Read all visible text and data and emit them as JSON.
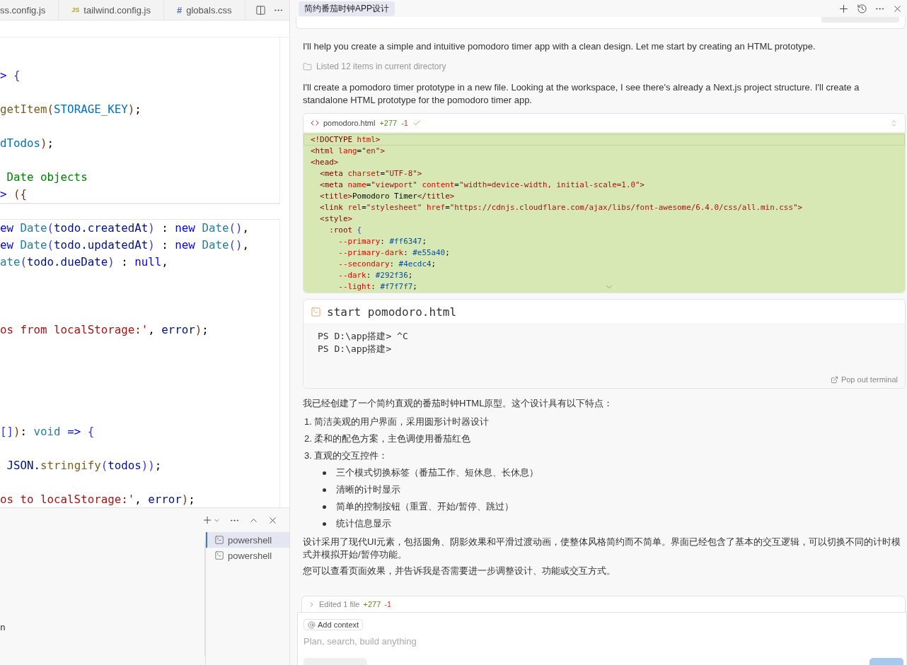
{
  "editor_tabs": [
    {
      "label": "ss.config.js"
    },
    {
      "badge": "JS",
      "label": "tailwind.config.js"
    },
    {
      "badge": "#",
      "label": "globals.css"
    }
  ],
  "sticky_lines": [
    {
      "kind": "blank"
    },
    {
      "kind": "code",
      "segments": [
        {
          "text": "> ",
          "kind": "keyword"
        },
        {
          "text": "{",
          "kind": "bracket"
        }
      ]
    },
    {
      "kind": "blank"
    },
    {
      "kind": "code",
      "segments": [
        {
          "text": "getItem",
          "kind": "function"
        },
        {
          "text": "(",
          "kind": "paren"
        },
        {
          "text": "STORAGE_KEY",
          "kind": "constant"
        },
        {
          "text": ")",
          "kind": "paren"
        },
        {
          "text": ";",
          "kind": "plain"
        }
      ]
    },
    {
      "kind": "blank"
    },
    {
      "kind": "code",
      "segments": [
        {
          "text": "dTodos",
          "kind": "constant"
        },
        {
          "text": ")",
          "kind": "paren"
        },
        {
          "text": ";",
          "kind": "plain"
        }
      ]
    },
    {
      "kind": "blank"
    },
    {
      "kind": "code",
      "segments": [
        {
          "text": " Date objects",
          "kind": "comment"
        }
      ]
    },
    {
      "kind": "code",
      "segments": [
        {
          "text": "> ",
          "kind": "keyword"
        },
        {
          "text": "({",
          "kind": "paren"
        }
      ]
    }
  ],
  "code_lines": [
    {
      "kind": "code",
      "segments": [
        {
          "text": "ew",
          "kind": "keyword"
        },
        {
          "text": " Date",
          "kind": "type"
        },
        {
          "text": "(",
          "kind": "bracket"
        },
        {
          "text": "todo.createdAt",
          "kind": "variable"
        },
        {
          "text": ")",
          "kind": "bracket"
        },
        {
          "text": " : ",
          "kind": "plain"
        },
        {
          "text": "new",
          "kind": "keyword"
        },
        {
          "text": " Date",
          "kind": "type"
        },
        {
          "text": "()",
          "kind": "bracket"
        },
        {
          "text": ",",
          "kind": "plain"
        }
      ]
    },
    {
      "kind": "code",
      "segments": [
        {
          "text": "ew",
          "kind": "keyword"
        },
        {
          "text": " Date",
          "kind": "type"
        },
        {
          "text": "(",
          "kind": "bracket"
        },
        {
          "text": "todo.updatedAt",
          "kind": "variable"
        },
        {
          "text": ")",
          "kind": "bracket"
        },
        {
          "text": " : ",
          "kind": "plain"
        },
        {
          "text": "new",
          "kind": "keyword"
        },
        {
          "text": " Date",
          "kind": "type"
        },
        {
          "text": "()",
          "kind": "bracket"
        },
        {
          "text": ",",
          "kind": "plain"
        }
      ]
    },
    {
      "kind": "code",
      "segments": [
        {
          "text": "ate",
          "kind": "type"
        },
        {
          "text": "(",
          "kind": "bracket"
        },
        {
          "text": "todo.dueDate",
          "kind": "variable"
        },
        {
          "text": ")",
          "kind": "bracket"
        },
        {
          "text": " : ",
          "kind": "plain"
        },
        {
          "text": "null",
          "kind": "keyword"
        },
        {
          "text": ",",
          "kind": "plain"
        }
      ]
    },
    {
      "kind": "blank"
    },
    {
      "kind": "blank"
    },
    {
      "kind": "blank"
    },
    {
      "kind": "code",
      "segments": [
        {
          "text": "os from localStorage:'",
          "kind": "string"
        },
        {
          "text": ", ",
          "kind": "plain"
        },
        {
          "text": "error",
          "kind": "variable"
        },
        {
          "text": ")",
          "kind": "paren"
        },
        {
          "text": ";",
          "kind": "plain"
        }
      ]
    },
    {
      "kind": "blank"
    },
    {
      "kind": "blank"
    },
    {
      "kind": "blank"
    },
    {
      "kind": "blank"
    },
    {
      "kind": "blank"
    },
    {
      "kind": "code",
      "segments": [
        {
          "text": "[]",
          "kind": "bracket"
        },
        {
          "text": ")",
          "kind": "paren"
        },
        {
          "text": ": ",
          "kind": "plain"
        },
        {
          "text": "void",
          "kind": "type"
        },
        {
          "text": " =>",
          "kind": "keyword"
        },
        {
          "text": " {",
          "kind": "bracket"
        }
      ]
    },
    {
      "kind": "blank"
    },
    {
      "kind": "code",
      "segments": [
        {
          "text": " JSON",
          "kind": "variable"
        },
        {
          "text": ".",
          "kind": "plain"
        },
        {
          "text": "stringify",
          "kind": "function"
        },
        {
          "text": "(",
          "kind": "bracket"
        },
        {
          "text": "todos",
          "kind": "variable"
        },
        {
          "text": "))",
          "kind": "bracket"
        },
        {
          "text": ";",
          "kind": "plain"
        }
      ]
    },
    {
      "kind": "blank"
    },
    {
      "kind": "code",
      "segments": [
        {
          "text": "os to localStorage:'",
          "kind": "string"
        },
        {
          "text": ", ",
          "kind": "plain"
        },
        {
          "text": "error",
          "kind": "variable"
        },
        {
          "text": ")",
          "kind": "paren"
        },
        {
          "text": ";",
          "kind": "plain"
        }
      ]
    }
  ],
  "terminal_panel": {
    "output": [
      "n"
    ],
    "sessions": [
      {
        "label": "powershell",
        "selected": true
      },
      {
        "label": "powershell",
        "selected": false
      }
    ]
  },
  "chat": {
    "title": "简约番茄时钟APP设计",
    "intro": "I'll help you create a simple and intuitive pomodoro timer app with a clean design. Let me start by creating an HTML prototype.",
    "tool_note": "Listed 12 items in current directory",
    "plan": "I'll create a pomodoro timer prototype in a new file. Looking at the workspace, I see there's already a Next.js project structure. I'll create a standalone HTML prototype for the pomodoro timer app.",
    "diff": {
      "file": "pomodoro.html",
      "added": "+277",
      "removed": "-1",
      "lines": [
        [
          {
            "text": "<!DOCTYPE",
            "kind": "tag"
          },
          {
            "text": " html",
            "kind": "attr"
          },
          {
            "text": ">",
            "kind": "tag"
          }
        ],
        [
          {
            "text": "<html",
            "kind": "tag"
          },
          {
            "text": " lang",
            "kind": "attr"
          },
          {
            "text": "=",
            "kind": "plain"
          },
          {
            "text": "\"en\"",
            "kind": "string"
          },
          {
            "text": ">",
            "kind": "tag"
          }
        ],
        [
          {
            "text": "<head>",
            "kind": "tag"
          }
        ],
        [
          {
            "text": "  <meta",
            "kind": "tag"
          },
          {
            "text": " charset",
            "kind": "attr"
          },
          {
            "text": "=",
            "kind": "plain"
          },
          {
            "text": "\"UTF-8\"",
            "kind": "string"
          },
          {
            "text": ">",
            "kind": "tag"
          }
        ],
        [
          {
            "text": "  <meta",
            "kind": "tag"
          },
          {
            "text": " name",
            "kind": "attr"
          },
          {
            "text": "=",
            "kind": "plain"
          },
          {
            "text": "\"viewport\"",
            "kind": "string"
          },
          {
            "text": " content",
            "kind": "attr"
          },
          {
            "text": "=",
            "kind": "plain"
          },
          {
            "text": "\"width=device-width, initial-scale=1.0\"",
            "kind": "string"
          },
          {
            "text": ">",
            "kind": "tag"
          }
        ],
        [
          {
            "text": "  <title>",
            "kind": "tag"
          },
          {
            "text": "Pomodoro Timer",
            "kind": "plain"
          },
          {
            "text": "</title>",
            "kind": "tag"
          }
        ],
        [
          {
            "text": "  <link",
            "kind": "tag"
          },
          {
            "text": " rel",
            "kind": "attr"
          },
          {
            "text": "=",
            "kind": "plain"
          },
          {
            "text": "\"stylesheet\"",
            "kind": "string"
          },
          {
            "text": " href",
            "kind": "attr"
          },
          {
            "text": "=",
            "kind": "plain"
          },
          {
            "text": "\"https://cdnjs.cloudflare.com/ajax/libs/font-awesome/6.4.0/css/all.min.css\"",
            "kind": "string"
          },
          {
            "text": ">",
            "kind": "tag"
          }
        ],
        [
          {
            "text": "  <style>",
            "kind": "tag"
          }
        ],
        [
          {
            "text": "    :root",
            "kind": "tag"
          },
          {
            "text": " {",
            "kind": "brace"
          }
        ],
        [
          {
            "text": "      --primary",
            "kind": "attr"
          },
          {
            "text": ": ",
            "kind": "plain"
          },
          {
            "text": "#ff6347",
            "kind": "value"
          },
          {
            "text": ";",
            "kind": "plain"
          }
        ],
        [
          {
            "text": "      --primary-dark",
            "kind": "attr"
          },
          {
            "text": ": ",
            "kind": "plain"
          },
          {
            "text": "#e55a40",
            "kind": "value"
          },
          {
            "text": ";",
            "kind": "plain"
          }
        ],
        [
          {
            "text": "      --secondary",
            "kind": "attr"
          },
          {
            "text": ": ",
            "kind": "plain"
          },
          {
            "text": "#4ecdc4",
            "kind": "value"
          },
          {
            "text": ";",
            "kind": "plain"
          }
        ],
        [
          {
            "text": "      --dark",
            "kind": "attr"
          },
          {
            "text": ": ",
            "kind": "plain"
          },
          {
            "text": "#292f36",
            "kind": "value"
          },
          {
            "text": ";",
            "kind": "plain"
          }
        ],
        [
          {
            "text": "      --light",
            "kind": "attr"
          },
          {
            "text": ": ",
            "kind": "plain"
          },
          {
            "text": "#f7f7f7",
            "kind": "value"
          },
          {
            "text": ";",
            "kind": "plain"
          }
        ]
      ]
    },
    "terminal": {
      "command": "start pomodoro.html",
      "output": [
        "PS D:\\app搭建> ^C",
        "PS D:\\app搭建>"
      ],
      "pop_out": "Pop out terminal"
    },
    "summary": "我已经创建了一个简约直观的番茄时钟HTML原型。这个设计具有以下特点：",
    "features": [
      {
        "marker": "1.",
        "text": "简洁美观的用户界面，采用圆形计时器设计"
      },
      {
        "marker": "2.",
        "text": "柔和的配色方案，主色调使用番茄红色"
      },
      {
        "marker": "3.",
        "text": "直观的交互控件：",
        "children": [
          {
            "text": "三个模式切换标签（番茄工作、短休息、长休息）"
          },
          {
            "text": "清晰的计时显示"
          },
          {
            "text": "简单的控制按钮（重置、开始/暂停、跳过）"
          },
          {
            "text": "统计信息显示"
          }
        ]
      }
    ],
    "closing": [
      "设计采用了现代UI元素，包括圆角、阴影效果和平滑过渡动画，使整体风格简约而不简单。界面已经包含了基本的交互逻辑，可以切换不同的计时模式并模拟开始/暂停功能。",
      "您可以查看页面效果，并告诉我是否需要进一步调整设计、功能或交互方式。"
    ],
    "edited": {
      "label": "Edited 1 file",
      "added": "+277",
      "removed": "-1"
    },
    "composer": {
      "context_button": "Add context",
      "placeholder": "Plan, search, build anything"
    }
  }
}
